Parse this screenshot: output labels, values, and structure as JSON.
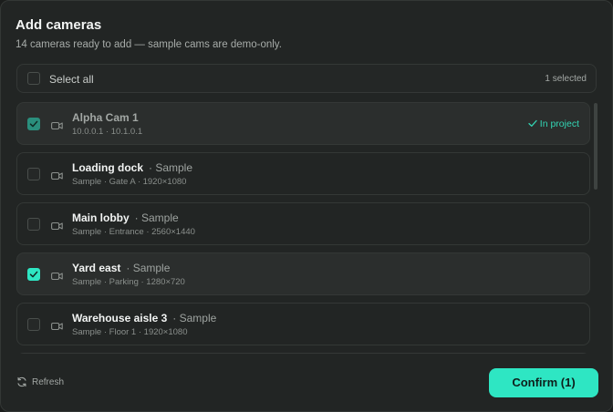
{
  "dialog": {
    "title": "Add cameras",
    "subtitle": "14 cameras ready to add — sample cams are demo-only."
  },
  "select_all": {
    "label": "Select all",
    "count": "1 selected"
  },
  "cameras": [
    {
      "name": "Alpha Cam 1",
      "tag": "",
      "meta": "10.0.0.1 · 10.1.0.1",
      "checked": true,
      "in_project": true,
      "in_project_label": "In project"
    },
    {
      "name": "Loading dock",
      "tag": "· Sample",
      "meta": "Sample · Gate A · 1920×1080",
      "checked": false,
      "in_project": false
    },
    {
      "name": "Main lobby",
      "tag": "· Sample",
      "meta": "Sample · Entrance · 2560×1440",
      "checked": false,
      "in_project": false
    },
    {
      "name": "Yard east",
      "tag": "· Sample",
      "meta": "Sample · Parking · 1280×720",
      "checked": true,
      "in_project": false
    },
    {
      "name": "Warehouse aisle 3",
      "tag": "· Sample",
      "meta": "Sample · Floor 1 · 1920×1080",
      "checked": false,
      "in_project": false
    }
  ],
  "footer": {
    "refresh_label": "Refresh",
    "confirm_label": "Confirm (1)"
  },
  "colors": {
    "accent": "#2ee6c3",
    "background": "#222524",
    "border": "#343836"
  },
  "icons": {
    "row": "camera-icon",
    "check": "check-icon",
    "refresh": "refresh-icon"
  }
}
